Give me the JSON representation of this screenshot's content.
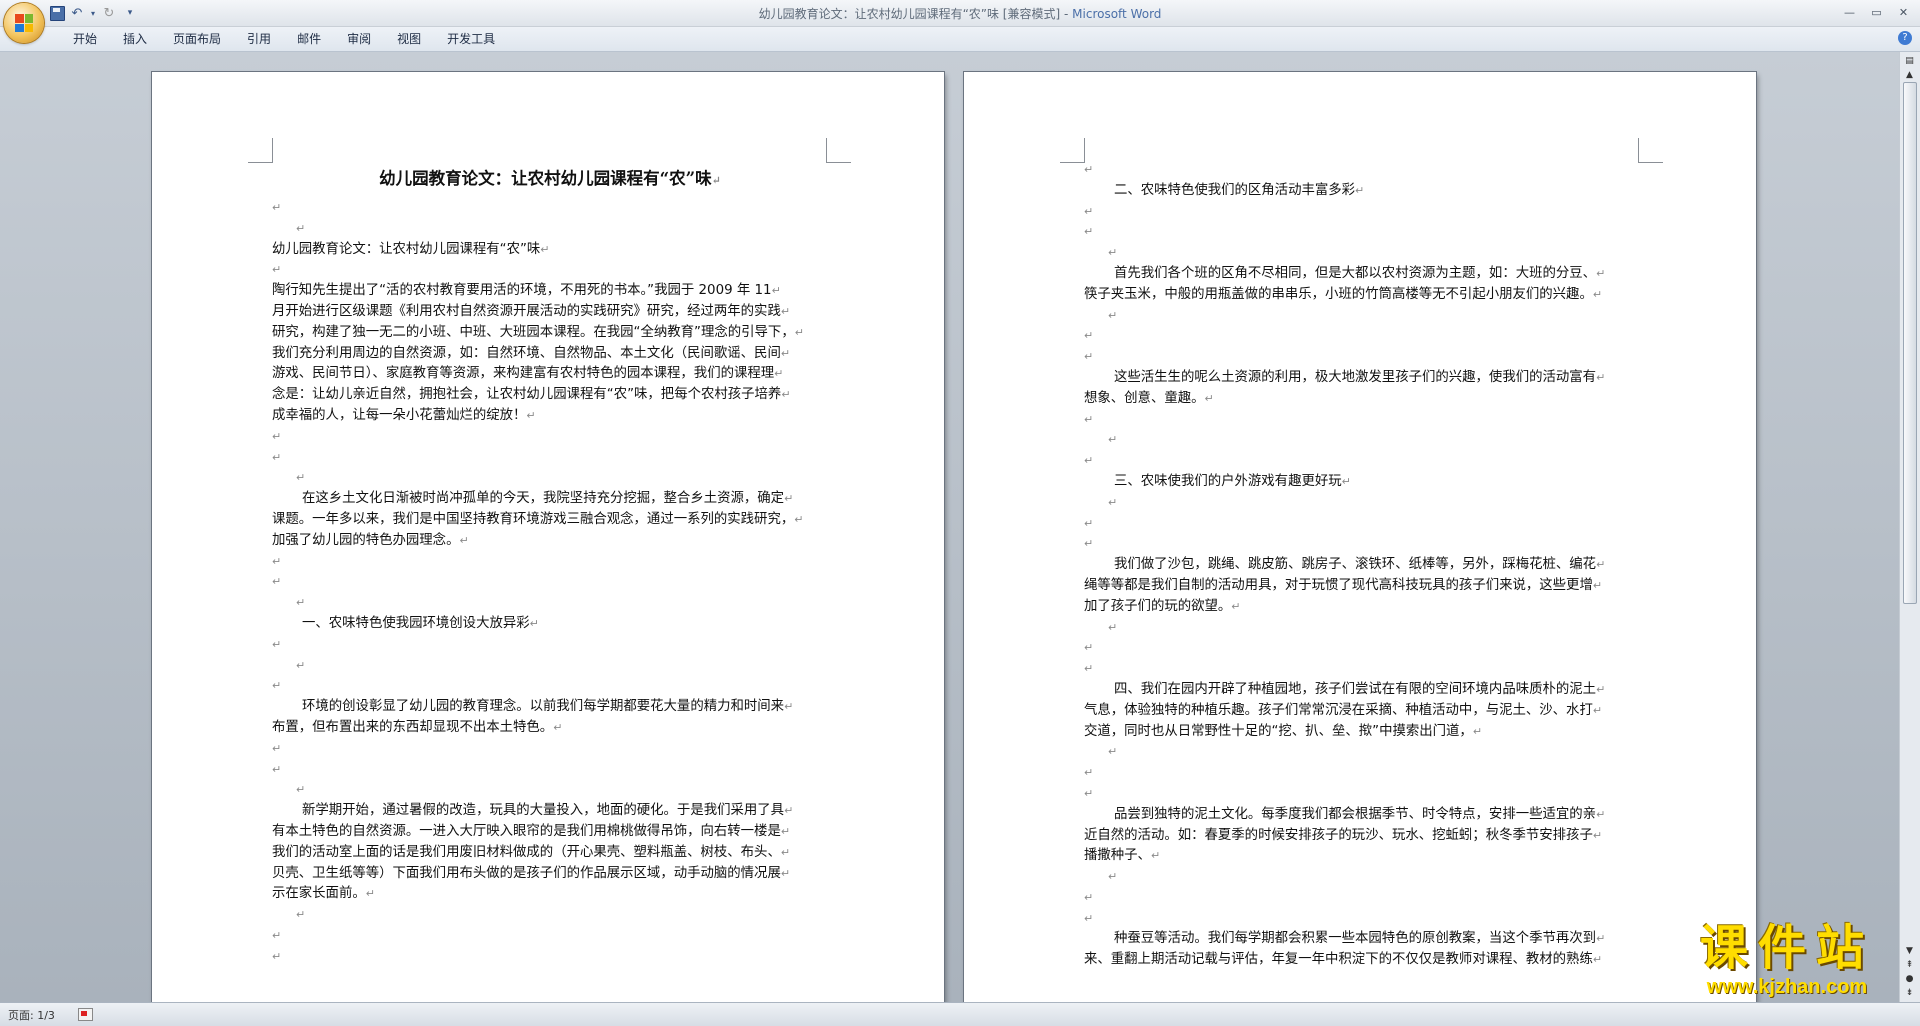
{
  "window": {
    "title": "幼儿园教育论文：让农村幼儿园课程有“农”味 [兼容模式]",
    "app_name": "Microsoft Word"
  },
  "ribbon": {
    "tabs": [
      "开始",
      "插入",
      "页面布局",
      "引用",
      "邮件",
      "审阅",
      "视图",
      "开发工具"
    ]
  },
  "document": {
    "title": "幼儿园教育论文：让农村幼儿园课程有“农”味",
    "left_lines": [
      "",
      "",
      "幼儿园教育论文：让农村幼儿园课程有“农”味",
      "",
      "陶行知先生提出了“活的农村教育要用活的环境，不用死的书本。”我园于 2009 年 11",
      "月开始进行区级课题《利用农村自然资源开展活动的实践研究》研究，经过两年的实践",
      "研究，构建了独一无二的小班、中班、大班园本课程。在我园“全纳教育”理念的引导下，",
      "我们充分利用周边的自然资源，如：自然环境、自然物品、本土文化（民间歌谣、民间",
      "游戏、民间节日）、家庭教育等资源，来构建富有农村特色的园本课程，我们的课程理",
      "念是：让幼儿亲近自然，拥抱社会，让农村幼儿园课程有“农”味，把每个农村孩子培养",
      "成幸福的人，让每一朵小花蕾灿烂的绽放！",
      "",
      "",
      "",
      "在这乡土文化日渐被时尚冲孤单的今天，我院坚持充分挖掘，整合乡土资源，确定",
      "课题。一年多以来，我们是中国坚持教育环境游戏三融合观念，通过一系列的实践研究，",
      "加强了幼儿园的特色办园理念。",
      "",
      "",
      "",
      "一、农味特色使我园环境创设大放异彩",
      "",
      "",
      "",
      "环境的创设彰显了幼儿园的教育理念。以前我们每学期都要花大量的精力和时间来",
      "布置，但布置出来的东西却显现不出本土特色。",
      "",
      "",
      "",
      "新学期开始，通过暑假的改造，玩具的大量投入，地面的硬化。于是我们采用了具",
      "有本土特色的自然资源。一进入大厅映入眼帘的是我们用棉桃做得吊饰，向右转一楼是",
      "我们的活动室上面的话是我们用废旧材料做成的（开心果壳、塑料瓶盖、树枝、布头、",
      "贝壳、卫生纸等等）下面我们用布头做的是孩子们的作品展示区域，动手动脑的情况展",
      "示在家长面前。",
      "",
      "",
      ""
    ],
    "right_lines": [
      "",
      "二、农味特色使我们的区角活动丰富多彩",
      "",
      "",
      "",
      "首先我们各个班的区角不尽相同，但是大都以农村资源为主题，如：大班的分豆、",
      "筷子夹玉米，中般的用瓶盖做的串串乐，小班的竹筒高楼等无不引起小朋友们的兴趣。",
      "",
      "",
      "",
      "这些活生生的呢么土资源的利用，极大地激发里孩子们的兴趣，使我们的活动富有",
      "想象、创意、童趣。",
      "",
      "",
      "",
      "三、农味使我们的户外游戏有趣更好玩",
      "",
      "",
      "",
      "我们做了沙包，跳绳、跳皮筋、跳房子、滚铁环、纸棒等，另外，踩梅花桩、编花",
      "绳等等都是我们自制的活动用具，对于玩惯了现代高科技玩具的孩子们来说，这些更增",
      "加了孩子们的玩的欲望。",
      "",
      "",
      "",
      "四、我们在园内开辟了种植园地，孩子们尝试在有限的空间环境内品味质朴的泥土",
      "气息，体验独特的种植乐趣。孩子们常常沉浸在采摘、种植活动中，与泥土、沙、水打",
      "交道，同时也从日常野性十足的“挖、扒、垒、揿”中摸索出门道，",
      "",
      "",
      "",
      "品尝到独特的泥土文化。每季度我们都会根据季节、时令特点，安排一些适宜的亲",
      "近自然的活动。如：春夏季的时候安排孩子的玩沙、玩水、挖蚯蚓；秋冬季节安排孩子",
      "播撒种子、",
      "",
      "",
      "",
      "种蚕豆等活动。我们每学期都会积累一些本园特色的原创教案，当这个季节再次到",
      "来、重翻上期活动记载与评估，年复一年中积淀下的不仅仅是教师对课程、教材的熟练"
    ]
  },
  "status": {
    "page_label": "页面: 1/3"
  },
  "watermark": {
    "text": "课件站",
    "url": "www.kjzhan.com"
  },
  "colors": {
    "accent": "#4b6fa8",
    "watermark": "#ffdd00"
  }
}
